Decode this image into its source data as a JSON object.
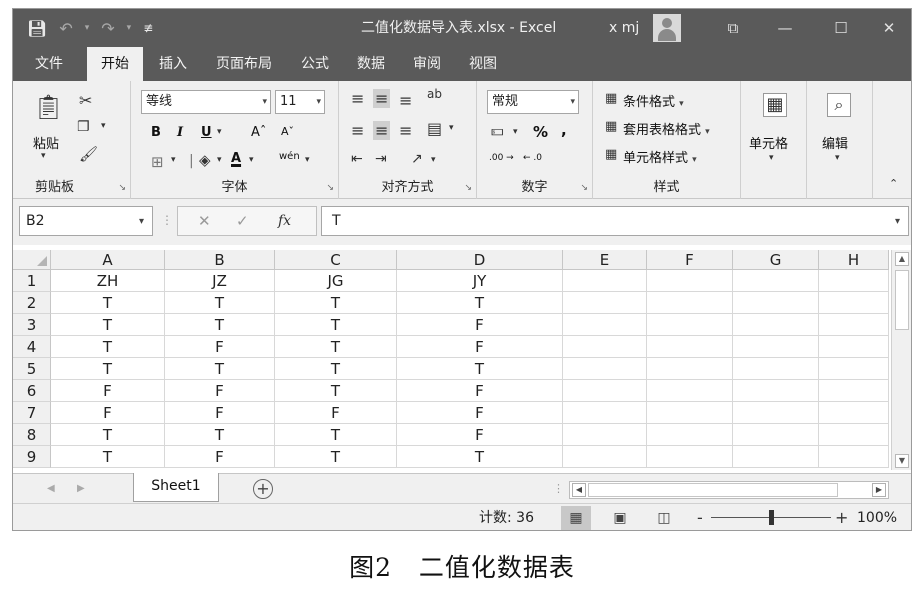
{
  "titlebar": {
    "filename": "二值化数据导入表.xlsx - Excel",
    "user": "x mj",
    "save_icon": "save-icon",
    "undo_icon": "undo-icon",
    "redo_icon": "redo-icon",
    "qat_menu": "≢",
    "ribbon_display": "⧉",
    "minimize": "—",
    "maximize": "☐",
    "close": "✕"
  },
  "menu": {
    "tabs": [
      "文件",
      "开始",
      "插入",
      "页面布局",
      "公式",
      "数据",
      "审阅",
      "视图"
    ],
    "active": "开始"
  },
  "ribbon": {
    "clipboard": {
      "label": "剪贴板",
      "paste": "粘贴"
    },
    "font": {
      "label": "字体",
      "name": "等线",
      "size": "11",
      "bold": "B",
      "italic": "I",
      "underline": "U",
      "grow": "Aˆ",
      "shrink": "Aˇ",
      "font_color": "A",
      "phonetic": "wén"
    },
    "alignment": {
      "label": "对齐方式"
    },
    "number": {
      "label": "数字",
      "format": "常规",
      "percent": "%",
      "comma": ",",
      "inc_decimal": ".00 →",
      "dec_decimal": "← .0"
    },
    "styles": {
      "label": "样式",
      "conditional": "条件格式",
      "table": "套用表格格式",
      "cell": "单元格样式"
    },
    "cells": {
      "label": "单元格"
    },
    "editing": {
      "label": "编辑"
    }
  },
  "formula_bar": {
    "name_box": "B2",
    "fx": "fx",
    "cancel": "✕",
    "enter": "✓",
    "value": "T"
  },
  "grid": {
    "columns": [
      "A",
      "B",
      "C",
      "D",
      "E",
      "F",
      "G",
      "H"
    ],
    "rows": [
      {
        "n": "1",
        "cells": [
          "ZH",
          "JZ",
          "JG",
          "JY"
        ]
      },
      {
        "n": "2",
        "cells": [
          "T",
          "T",
          "T",
          "T"
        ]
      },
      {
        "n": "3",
        "cells": [
          "T",
          "T",
          "T",
          "F"
        ]
      },
      {
        "n": "4",
        "cells": [
          "T",
          "F",
          "T",
          "F"
        ]
      },
      {
        "n": "5",
        "cells": [
          "T",
          "T",
          "T",
          "T"
        ]
      },
      {
        "n": "6",
        "cells": [
          "F",
          "F",
          "T",
          "F"
        ]
      },
      {
        "n": "7",
        "cells": [
          "F",
          "F",
          "F",
          "F"
        ]
      },
      {
        "n": "8",
        "cells": [
          "T",
          "T",
          "T",
          "F"
        ]
      },
      {
        "n": "9",
        "cells": [
          "T",
          "F",
          "T",
          "T"
        ]
      }
    ]
  },
  "sheets": {
    "tabs": [
      "Sheet1"
    ],
    "add": "+",
    "nav_prev": "◀",
    "nav_next": "▶"
  },
  "status": {
    "count_label": "计数: 36",
    "zoom": "100%",
    "zoom_minus": "-",
    "zoom_plus": "+",
    "zoom_fraction": 0.5
  },
  "caption": "图2   二值化数据表"
}
